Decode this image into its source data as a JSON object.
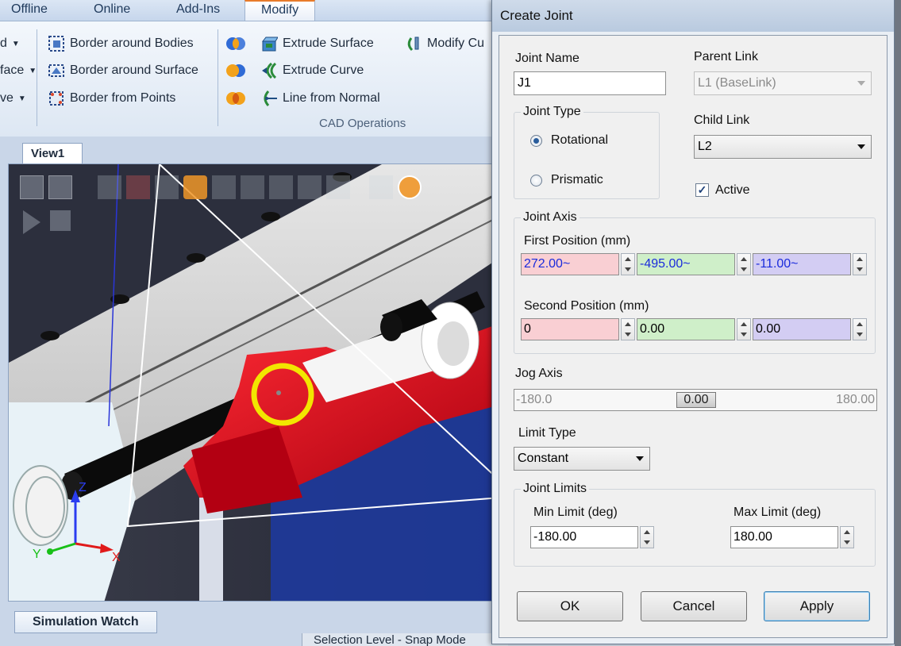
{
  "ribbon": {
    "tabs": [
      "Offline",
      "Online",
      "Add-Ins",
      "Modify"
    ],
    "active_tab": "Modify",
    "left_items": [
      "d",
      "face",
      "ve"
    ],
    "border_items": [
      "Border around Bodies",
      "Border around Surface",
      "Border from Points"
    ],
    "cad_items": [
      "Extrude Surface",
      "Extrude Curve",
      "Line from Normal"
    ],
    "modify_item": "Modify Cu",
    "group_label": "CAD Operations"
  },
  "document": {
    "view_tab": "View1",
    "bottom_tab": "Simulation Watch",
    "status_text": "Selection Level - Snap Mode",
    "axes": {
      "z": "Z",
      "y": "Y",
      "x": "X"
    }
  },
  "dialog": {
    "title": "Create Joint",
    "joint_name_label": "Joint Name",
    "joint_name_value": "J1",
    "parent_link_label": "Parent Link",
    "parent_link_value": "L1 (BaseLink)",
    "joint_type_label": "Joint Type",
    "rotational_label": "Rotational",
    "prismatic_label": "Prismatic",
    "joint_type_selected": "Rotational",
    "child_link_label": "Child Link",
    "child_link_value": "L2",
    "active_label": "Active",
    "active_checked": true,
    "joint_axis_label": "Joint Axis",
    "first_position_label": "First Position (mm)",
    "first_position": [
      "272.00~",
      "-495.00~",
      "-11.00~"
    ],
    "second_position_label": "Second Position (mm)",
    "second_position": [
      "0",
      "0.00",
      "0.00"
    ],
    "jog_axis_label": "Jog Axis",
    "jog_min": "-180.0",
    "jog_value": "0.00",
    "jog_max": "180.00",
    "limit_type_label": "Limit Type",
    "limit_type_value": "Constant",
    "joint_limits_label": "Joint Limits",
    "min_limit_label": "Min Limit (deg)",
    "min_limit_value": "-180.00",
    "max_limit_label": "Max Limit (deg)",
    "max_limit_value": "180.00",
    "ok_label": "OK",
    "cancel_label": "Cancel",
    "apply_label": "Apply"
  },
  "colors": {
    "x_field": "#f9cfd3",
    "y_field": "#cfefc9",
    "z_field": "#d3cdf3",
    "highlight_ring": "#f2e600",
    "robot_red": "#e4001a"
  }
}
